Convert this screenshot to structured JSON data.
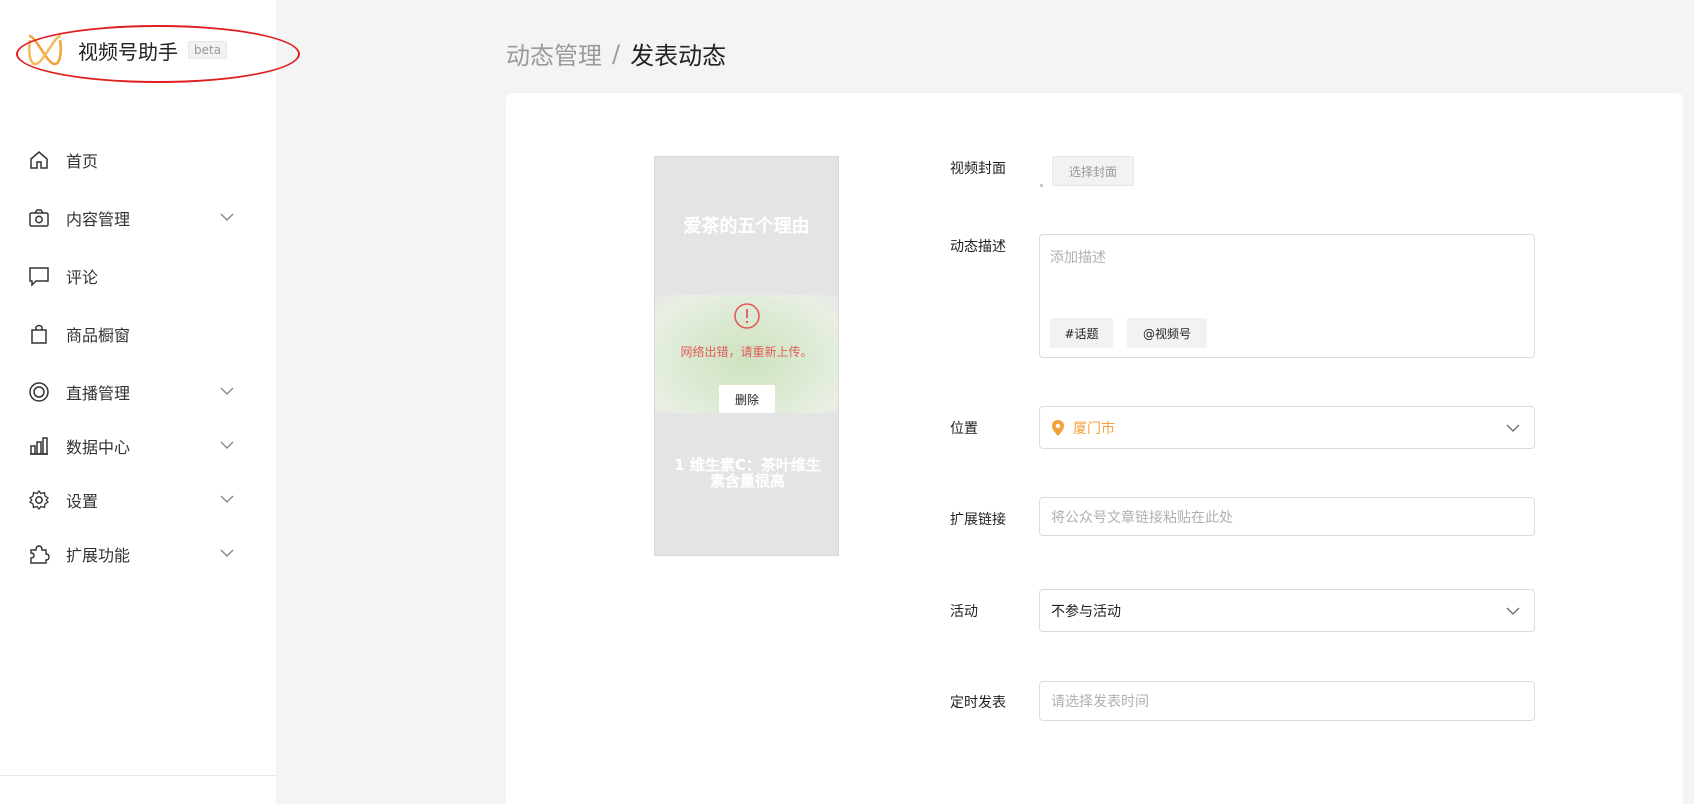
{
  "brand": {
    "name": "视频号助手",
    "badge": "beta"
  },
  "sidebar": {
    "items": [
      {
        "label": "首页",
        "icon": "home-icon",
        "expandable": false
      },
      {
        "label": "内容管理",
        "icon": "camera-icon",
        "expandable": true
      },
      {
        "label": "评论",
        "icon": "comment-icon",
        "expandable": false
      },
      {
        "label": "商品橱窗",
        "icon": "shopping-bag-icon",
        "expandable": false
      },
      {
        "label": "直播管理",
        "icon": "live-icon",
        "expandable": true
      },
      {
        "label": "数据中心",
        "icon": "bar-chart-icon",
        "expandable": true
      },
      {
        "label": "设置",
        "icon": "gear-icon",
        "expandable": true
      },
      {
        "label": "扩展功能",
        "icon": "puzzle-icon",
        "expandable": true
      }
    ]
  },
  "breadcrumb": {
    "parent": "动态管理",
    "separator": "/",
    "current": "发表动态"
  },
  "preview": {
    "title": "爱茶的五个理由",
    "error": "网络出错，请重新上传。",
    "delete_label": "删除",
    "subtitle": "1 维生素C：茶叶维生素含量很高"
  },
  "form": {
    "cover": {
      "label": "视频封面",
      "button": "选择封面"
    },
    "description": {
      "label": "动态描述",
      "placeholder": "添加描述",
      "topic_button": "#话题",
      "mention_button": "@视频号"
    },
    "location": {
      "label": "位置",
      "value": "厦门市"
    },
    "link": {
      "label": "扩展链接",
      "placeholder": "将公众号文章链接粘贴在此处"
    },
    "activity": {
      "label": "活动",
      "value": "不参与活动"
    },
    "schedule": {
      "label": "定时发表",
      "placeholder": "请选择发表时间"
    }
  },
  "colors": {
    "accent": "#f5a13a",
    "error": "#e25b5b",
    "annotation": "#e01e1e"
  }
}
